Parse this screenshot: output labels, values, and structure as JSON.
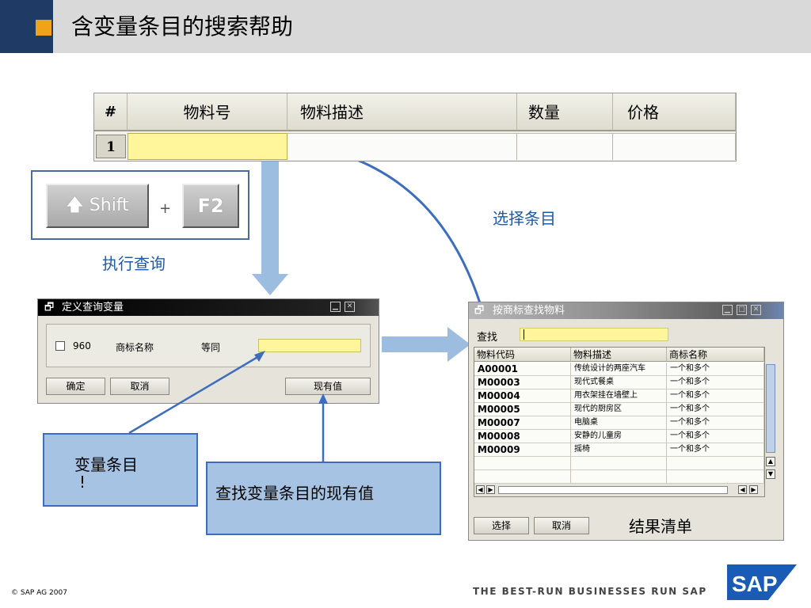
{
  "header": {
    "title": "含变量条目的搜索帮助"
  },
  "entry_table": {
    "columns": [
      "#",
      "物料号",
      "物料描述",
      "数量",
      "价格"
    ],
    "row_number": "1"
  },
  "shortcut": {
    "shift_label": "Shift",
    "plus": "+",
    "f2_label": "F2",
    "caption": "执行查询"
  },
  "select_entry_label": "选择条目",
  "var_dialog": {
    "title": "定义查询变量",
    "code": "960",
    "field_label": "商标名称",
    "operator": "等同",
    "ok_button": "确定",
    "cancel_button": "取消",
    "current_value_button": "现有值"
  },
  "result_dialog": {
    "title": "按商标查找物料",
    "find_label": "查找",
    "columns": [
      "物料代码",
      "物料描述",
      "商标名称"
    ],
    "rows": [
      {
        "code": "A00001",
        "desc": "传统设计的两座汽车",
        "brand": "一个和多个"
      },
      {
        "code": "M00003",
        "desc": "现代式餐桌",
        "brand": "一个和多个"
      },
      {
        "code": "M00004",
        "desc": "用衣架挂在墙壁上",
        "brand": "一个和多个"
      },
      {
        "code": "M00005",
        "desc": "现代的厨房区",
        "brand": "一个和多个"
      },
      {
        "code": "M00007",
        "desc": "电脑桌",
        "brand": "一个和多个"
      },
      {
        "code": "M00008",
        "desc": "安静的儿童房",
        "brand": "一个和多个"
      },
      {
        "code": "M00009",
        "desc": "摇椅",
        "brand": "一个和多个"
      }
    ],
    "select_button": "选择",
    "cancel_button": "取消",
    "caption": "结果清单"
  },
  "callouts": {
    "variable_entry": "变量条目",
    "variable_entry_mark": "!",
    "find_current": "查找变量条目的现有值"
  },
  "footer": {
    "copyright": "©  SAP AG 2007",
    "tagline": "THE BEST-RUN BUSINESSES RUN SAP",
    "logo_text": "SAP"
  },
  "colors": {
    "header_blue": "#1f3a64",
    "header_orange": "#f0a318",
    "input_yellow": "#fff59a",
    "callout_fill": "#a7c3e4",
    "callout_border": "#3d6dbd",
    "label_blue": "#1f5aa6"
  }
}
